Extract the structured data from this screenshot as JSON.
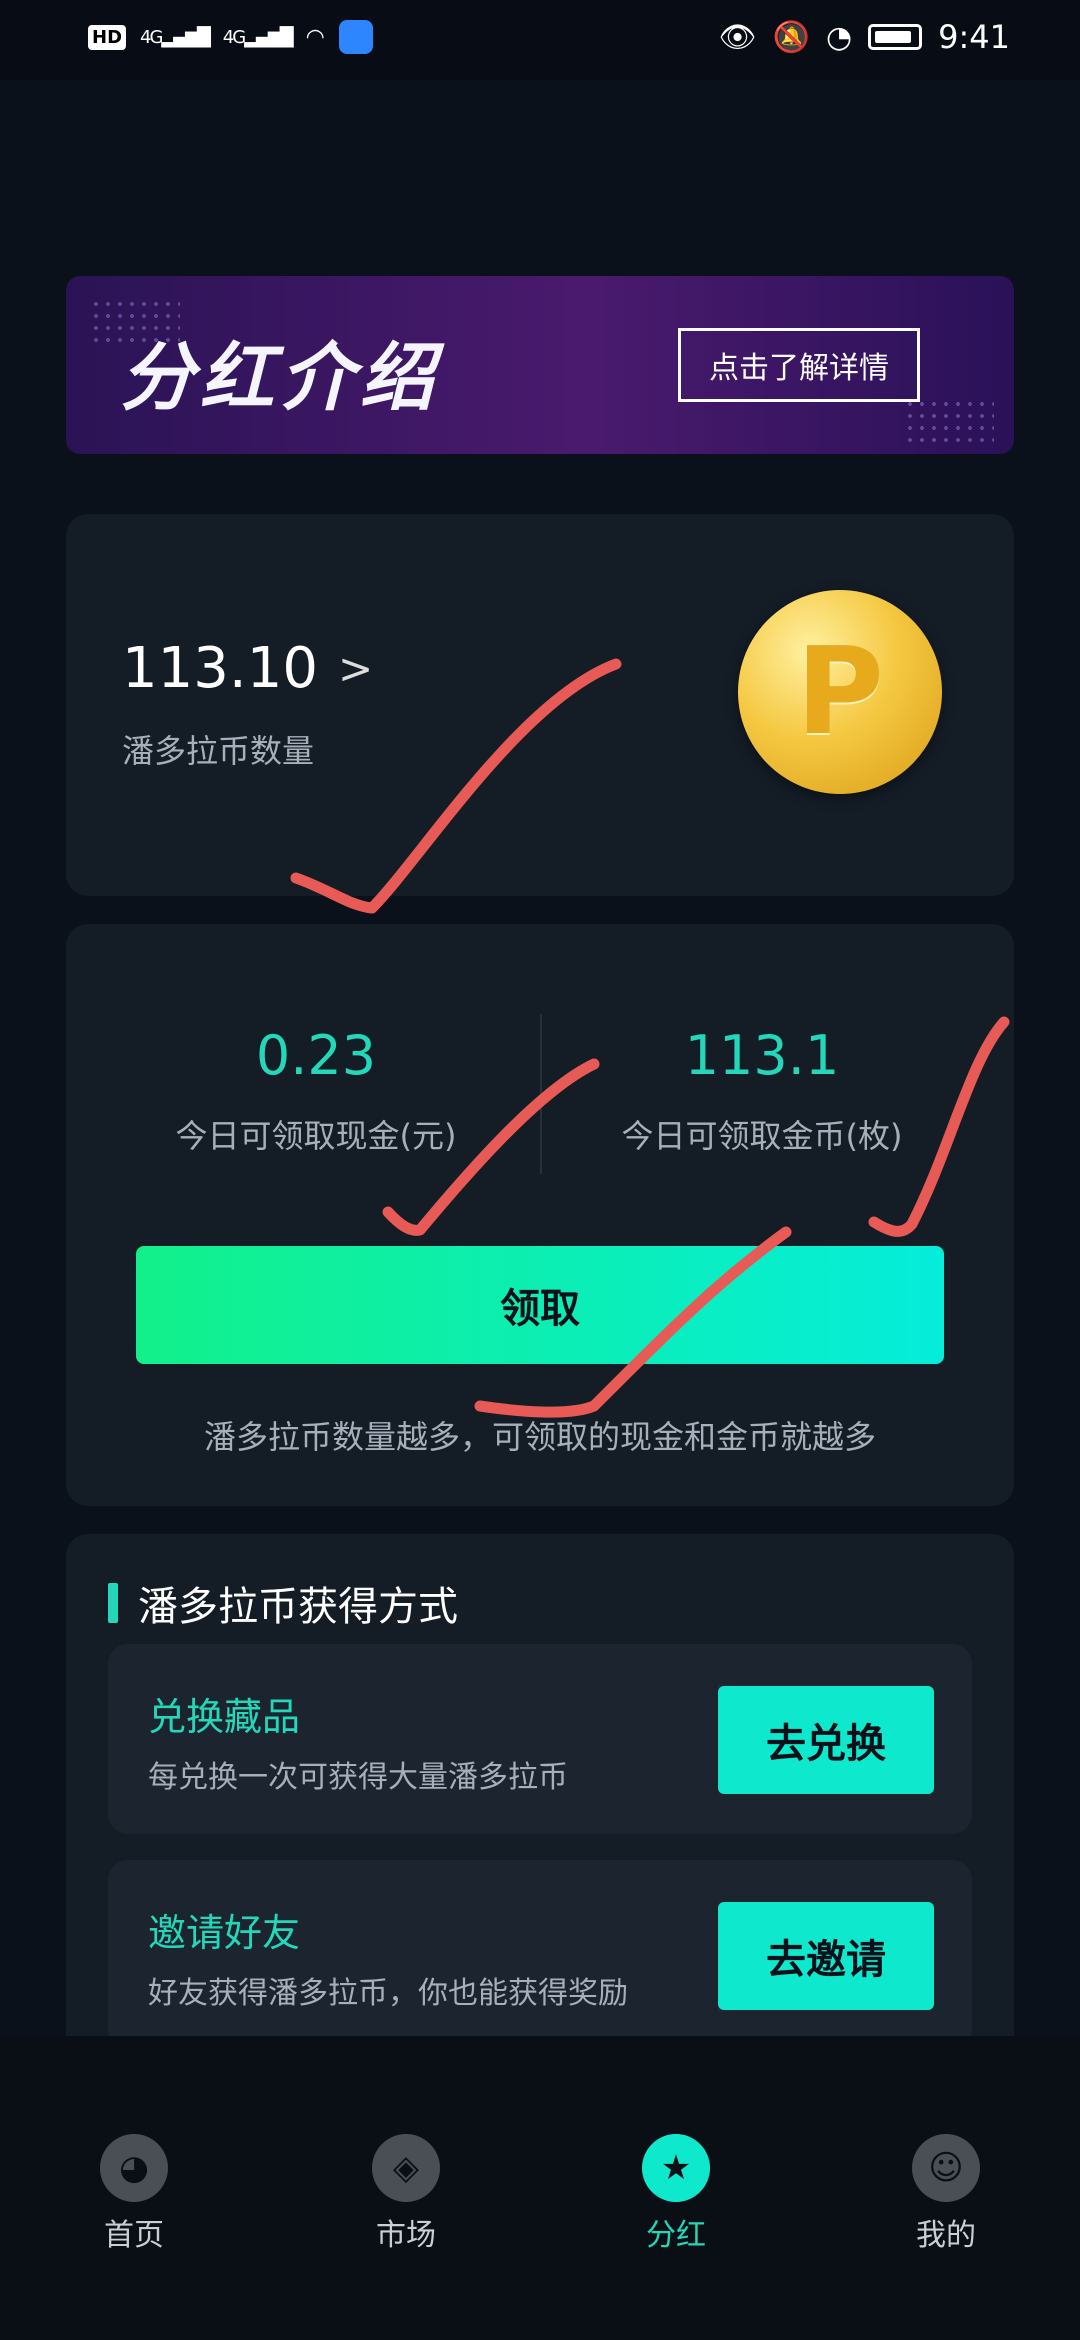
{
  "statusbar": {
    "hd": "HD",
    "signal1": "4G",
    "signal2": "4G",
    "time": "9:41"
  },
  "banner": {
    "title": "分红介绍",
    "button": "点击了解详情"
  },
  "balance": {
    "amount": "113.10",
    "chevron": ">",
    "label": "潘多拉币数量",
    "coin_letter": "P"
  },
  "claim": {
    "cash_value": "0.23",
    "cash_label": "今日可领取现金(元)",
    "gold_value": "113.1",
    "gold_label": "今日可领取金币(枚)",
    "button": "领取",
    "hint": "潘多拉币数量越多，可领取的现金和金币就越多"
  },
  "ways": {
    "title": "潘多拉币获得方式",
    "items": [
      {
        "title": "兑换藏品",
        "desc": "每兑换一次可获得大量潘多拉币",
        "button": "去兑换"
      },
      {
        "title": "邀请好友",
        "desc": "好友获得潘多拉币，你也能获得奖励",
        "button": "去邀请"
      }
    ]
  },
  "tabs": [
    {
      "label": "首页",
      "icon": "pacman-icon"
    },
    {
      "label": "市场",
      "icon": "compass-icon"
    },
    {
      "label": "分红",
      "icon": "star-medal-icon",
      "active": true
    },
    {
      "label": "我的",
      "icon": "smile-face-icon"
    }
  ],
  "colors": {
    "accent": "#23d7b8",
    "background": "#0b111b",
    "card": "#141c26",
    "annotation": "#e85a55"
  }
}
